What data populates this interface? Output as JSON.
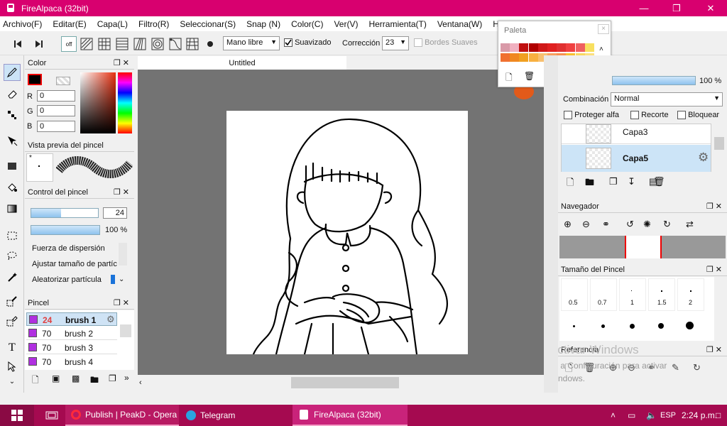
{
  "window": {
    "title": "FireAlpaca (32bit)"
  },
  "menu": [
    "Archivo(F)",
    "Editar(E)",
    "Capa(L)",
    "Filtro(R)",
    "Seleccionar(S)",
    "Snap (N)",
    "Color(C)",
    "Ver(V)",
    "Herramienta(T)",
    "Ventana(W)",
    "He"
  ],
  "toolbar": {
    "snap_off": "off",
    "mode_value": "Mano libre",
    "smoothing_label": "Suavizado",
    "correction_label": "Corrección",
    "correction_value": "23",
    "soft_edges_label": "Bordes Suaves"
  },
  "color_panel": {
    "title": "Color",
    "r_label": "R",
    "g_label": "G",
    "b_label": "B",
    "r": "0",
    "g": "0",
    "b": "0",
    "current_color": "#000000"
  },
  "brush_preview": {
    "title": "Vista previa del pincel",
    "star": "*"
  },
  "brush_control": {
    "title": "Control del pincel",
    "size": "24",
    "opacity": "100 %",
    "size_fraction": 0.45,
    "opacity_fraction": 1.0,
    "dispersion": "Fuerza de dispersión",
    "adjust_size": "Ajustar tamaño de partíc",
    "randomize": "Aleatorizar partícula"
  },
  "brush_panel": {
    "title": "Pincel",
    "items": [
      {
        "size": "24",
        "name": "brush 1",
        "selected": true
      },
      {
        "size": "70",
        "name": "brush 2",
        "selected": false
      },
      {
        "size": "70",
        "name": "brush 3",
        "selected": false
      },
      {
        "size": "70",
        "name": "brush 4",
        "selected": false
      }
    ]
  },
  "canvas": {
    "tab": "Untitled"
  },
  "palette": {
    "title": "Paleta",
    "label": "---",
    "colors_row1": [
      "#d99aa8",
      "#f0b0c0",
      "#c01010",
      "#b00000",
      "#d01818",
      "#e02020",
      "#e03030",
      "#f04040",
      "#f06060",
      "#f8e060"
    ],
    "colors_row2": [
      "#f07030",
      "#f08820",
      "#f0a020",
      "#f8b040",
      "#f8c070",
      "#f8a060",
      "#f89050",
      "#f8c030",
      "#f8d860",
      "#fce080"
    ]
  },
  "layers": {
    "opacity": "100 %",
    "blend_label": "Combinación",
    "blend_value": "Normal",
    "protect_alpha": "Proteger alfa",
    "clipping": "Recorte",
    "lock": "Bloquear",
    "items": [
      {
        "name": "Capa3",
        "selected": false
      },
      {
        "name": "Capa5",
        "selected": true
      }
    ]
  },
  "navigator": {
    "title": "Navegador"
  },
  "brush_size": {
    "title": "Tamaño del Pincel",
    "sizes": [
      "0.5",
      "0.7",
      "1",
      "1.5",
      "2"
    ]
  },
  "reference": {
    "title": "Referencia",
    "watermark1": "Activar Windows",
    "watermark2": "Ve a Configuración para activar",
    "watermark3": "Windows."
  },
  "taskbar": {
    "items": [
      "Publish | PeakD - Opera",
      "Telegram",
      "FireAlpaca (32bit)"
    ],
    "lang": "ESP",
    "time": "2:24 p.m."
  }
}
